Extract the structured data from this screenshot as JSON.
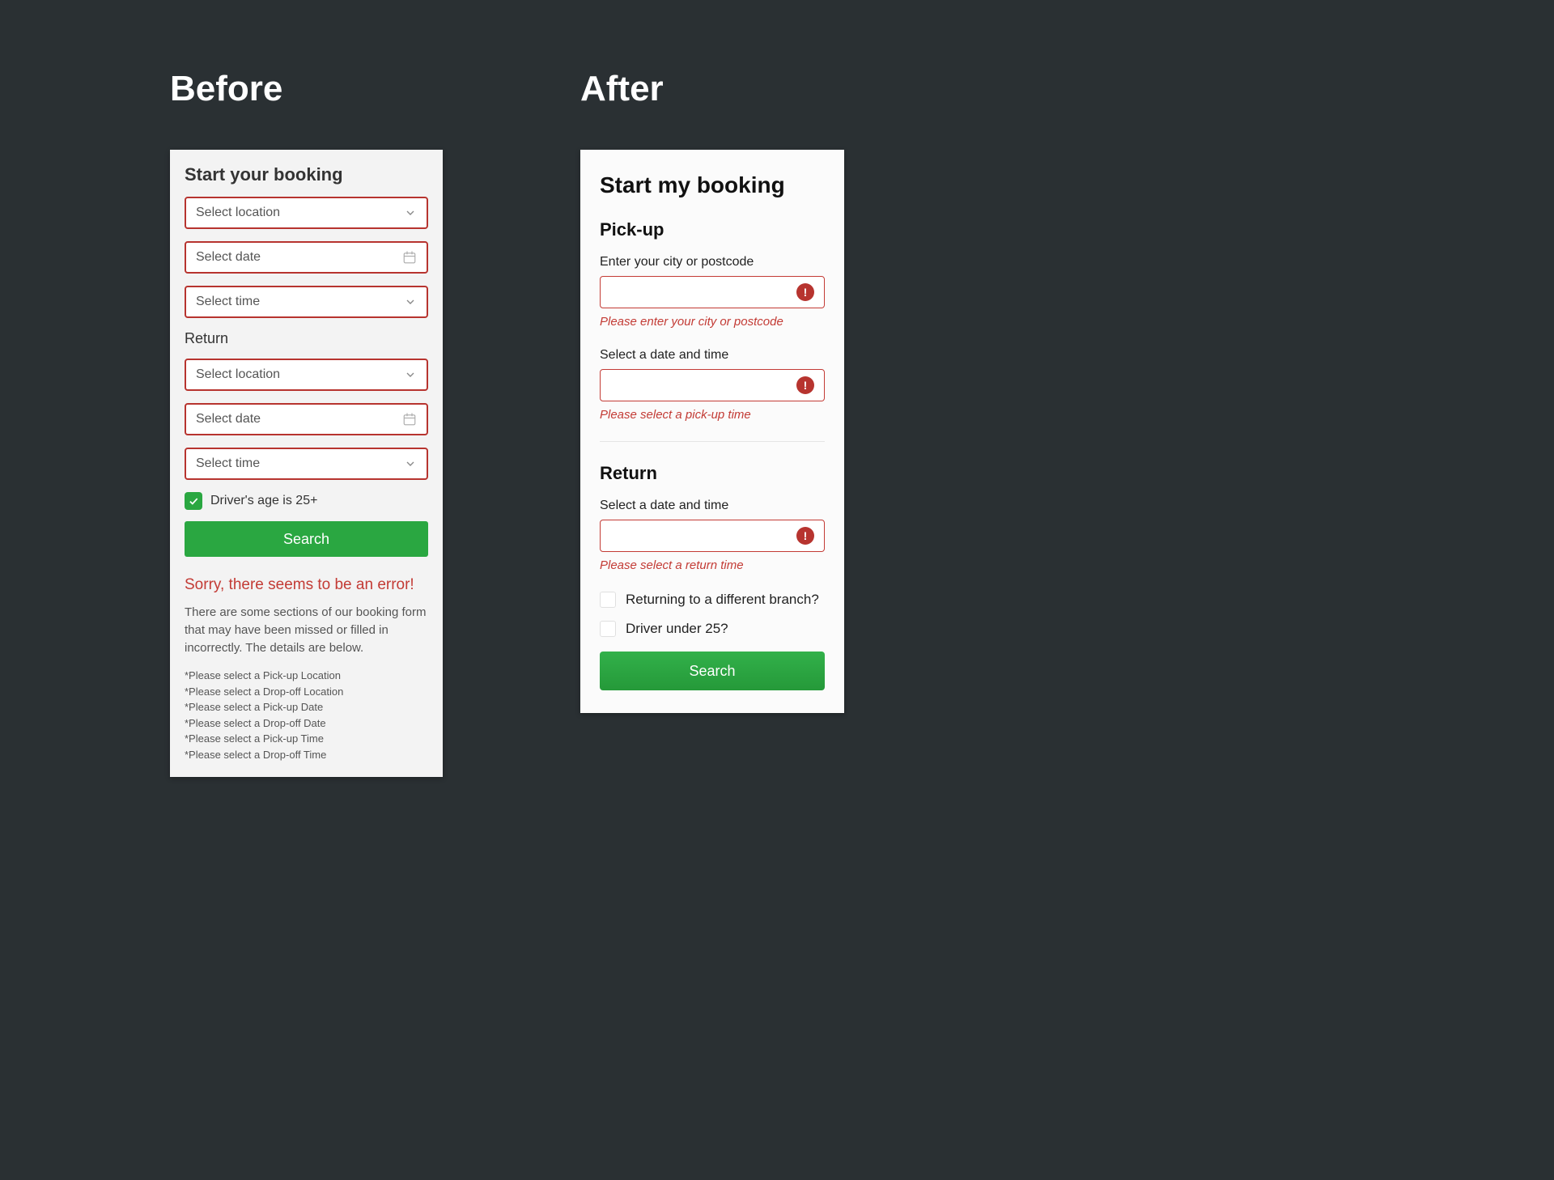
{
  "headings": {
    "before": "Before",
    "after": "After"
  },
  "before": {
    "title": "Start your booking",
    "select_location": "Select location",
    "select_date": "Select date",
    "select_time": "Select time",
    "return_label": "Return",
    "driver_age_label": "Driver's age is 25+",
    "search_label": "Search",
    "error_heading": "Sorry, there seems to be an error!",
    "error_body": "There are some sections of our booking form that may have been missed or filled in incorrectly. The details are below.",
    "error_list": [
      "*Please select a Pick-up Location",
      "*Please select a Drop-off Location",
      "*Please select a Pick-up Date",
      "*Please select a Drop-off Date",
      "*Please select a Pick-up Time",
      "*Please select a Drop-off Time"
    ]
  },
  "after": {
    "title": "Start my booking",
    "pickup_heading": "Pick-up",
    "city_label": "Enter your city or postcode",
    "city_error": "Please enter your city or postcode",
    "datetime_label": "Select a date and time",
    "pickup_time_error": "Please select a pick-up time",
    "return_heading": "Return",
    "return_datetime_label": "Select a date and time",
    "return_time_error": "Please select a return time",
    "diff_branch_label": "Returning to a different branch?",
    "under25_label": "Driver under 25?",
    "search_label": "Search",
    "error_glyph": "!"
  }
}
